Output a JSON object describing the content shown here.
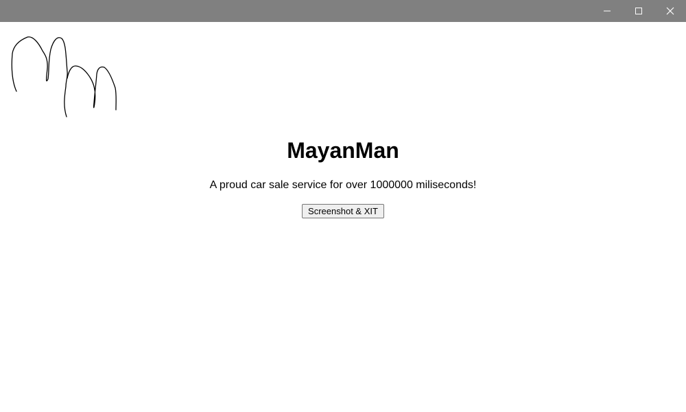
{
  "window": {
    "controls": {
      "minimize_icon": "minimize-icon",
      "maximize_icon": "maximize-icon",
      "close_icon": "close-icon"
    },
    "titlebar_color": "#808080"
  },
  "logo": {
    "icon": "hand-drawn-logo"
  },
  "main": {
    "title": "MayanMan",
    "tagline": "A proud car sale service for over 1000000 miliseconds!",
    "button_label": "Screenshot & XIT"
  }
}
